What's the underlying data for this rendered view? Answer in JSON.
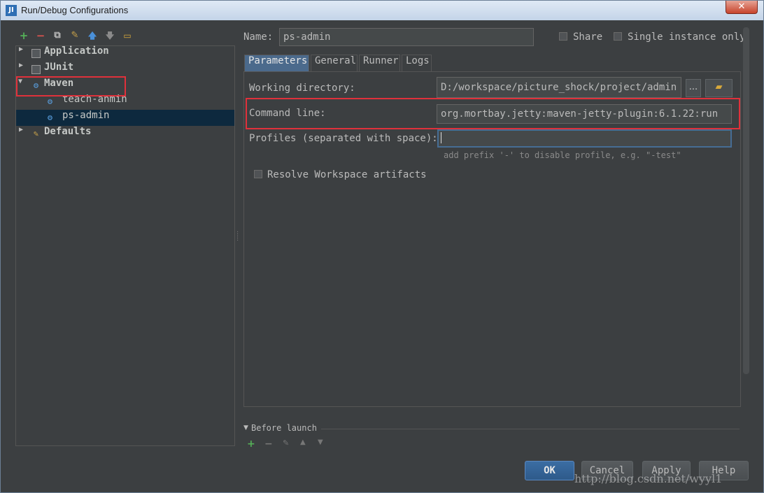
{
  "window": {
    "title": "Run/Debug Configurations",
    "app_icon_text": "JI",
    "close_glyph": "✕"
  },
  "toolbar": {
    "add": "+",
    "remove": "−",
    "copy": "⧉",
    "edit": "✎",
    "up": "🡅",
    "down": "🡇",
    "folder": "▭"
  },
  "tree": {
    "items": [
      {
        "label": "Application",
        "expanded": false
      },
      {
        "label": "JUnit",
        "expanded": false
      },
      {
        "label": "Maven",
        "expanded": true
      },
      {
        "label": "teach-anmin"
      },
      {
        "label": "ps-admin",
        "selected": true
      },
      {
        "label": "Defaults",
        "expanded": false
      }
    ]
  },
  "config": {
    "name_label": "Name:",
    "name_value": "ps-admin",
    "share_label": "Share",
    "single_instance_label": "Single instance only"
  },
  "tabs": [
    {
      "label": "Parameters",
      "active": true
    },
    {
      "label": "General"
    },
    {
      "label": "Runner"
    },
    {
      "label": "Logs"
    }
  ],
  "parameters": {
    "working_dir_label": "Working directory:",
    "working_dir_value": "D:/workspace/picture_shock/project/admin",
    "browse_label": "...",
    "command_line_label": "Command line:",
    "command_line_value": "org.mortbay.jetty:maven-jetty-plugin:6.1.22:run",
    "profiles_label": "Profiles (separated with space):",
    "profiles_value": "",
    "profiles_hint": "add prefix '-' to disable profile, e.g. \"-test\"",
    "resolve_label": "Resolve Workspace artifacts"
  },
  "before_launch": {
    "label": "Before launch",
    "icons": {
      "add": "+",
      "remove": "−",
      "edit": "✎",
      "up": "▲",
      "down": "▼"
    }
  },
  "buttons": {
    "ok": "OK",
    "cancel": "Cancel",
    "apply": "Apply",
    "help": "Help"
  },
  "watermark": "http://blog.csdn.net/wyyl1",
  "colors": {
    "highlight_box": "#e0313b",
    "selection": "#0d293e",
    "accent_tab": "#4b6a8c",
    "add_green": "#55b158",
    "remove_red": "#d9534f",
    "arrow_blue": "#4a90d9",
    "folder_yellow": "#d9a93b",
    "maven_blue": "#5aa0e0"
  }
}
